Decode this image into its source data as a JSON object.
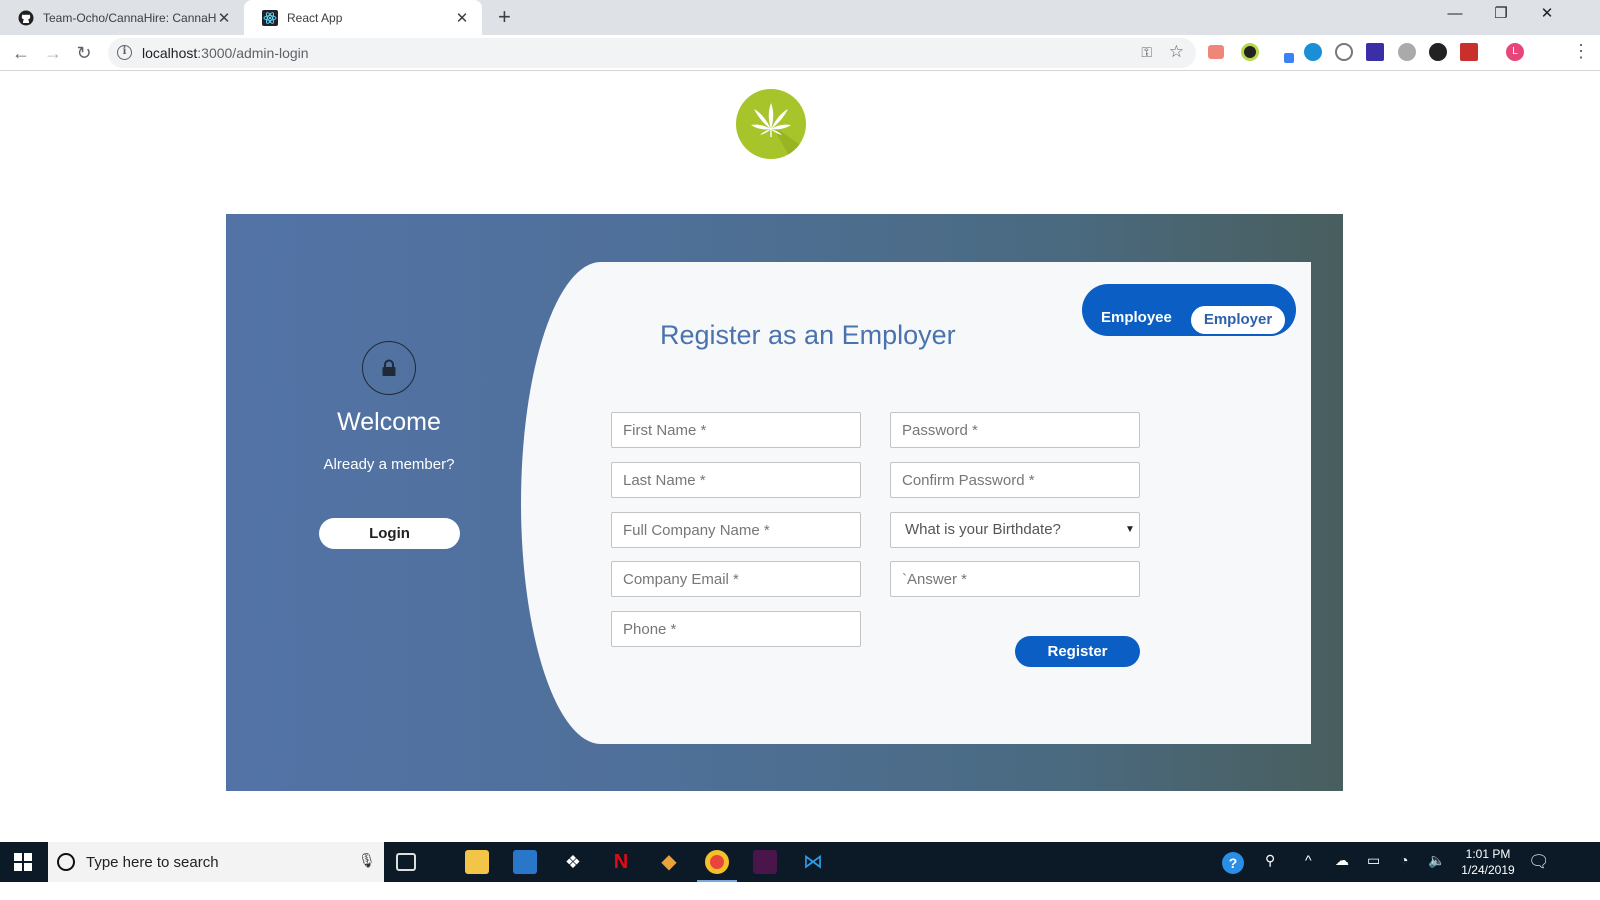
{
  "browser": {
    "tabs": [
      {
        "title": "Team-Ocho/CannaHire: CannaHi",
        "favicon": "github-icon",
        "active": false
      },
      {
        "title": "React App",
        "favicon": "react-icon",
        "active": true
      }
    ],
    "address": {
      "host": "localhost",
      "path": ":3000/admin-login"
    },
    "controls": {
      "minimize": "—",
      "restore": "❐",
      "close": "✕",
      "new_tab": "+"
    }
  },
  "page": {
    "logo": "cannabis-leaf-logo",
    "welcome": {
      "title": "Welcome",
      "subtitle": "Already a member?",
      "login_label": "Login"
    },
    "register": {
      "title": "Register as an Employer",
      "toggle": {
        "left_label": "Employee",
        "right_label": "Employer",
        "selected": "Employer"
      },
      "left_fields": [
        {
          "name": "first-name-input",
          "placeholder": "First Name *"
        },
        {
          "name": "last-name-input",
          "placeholder": "Last Name *"
        },
        {
          "name": "company-name-input",
          "placeholder": "Full Company Name *"
        },
        {
          "name": "company-email-input",
          "placeholder": "Company Email *"
        },
        {
          "name": "phone-input",
          "placeholder": "Phone *"
        }
      ],
      "right_fields": {
        "password": "Password *",
        "confirm_password": "Confirm Password *",
        "security_question": "What is your Birthdate?",
        "answer": "`Answer *"
      },
      "submit_label": "Register"
    },
    "colors": {
      "accent": "#0a5ec4",
      "panel_start": "#5373a7",
      "panel_end": "#495e5e",
      "title": "#4a73ad",
      "logo": "#a7c42a"
    }
  },
  "taskbar": {
    "search_placeholder": "Type here to search",
    "apps": [
      "file-explorer-icon",
      "store-icon",
      "dropbox-icon",
      "netflix-icon",
      "git-icon",
      "chrome-icon",
      "slack-icon",
      "vscode-icon"
    ],
    "clock": {
      "time": "1:01 PM",
      "date": "1/24/2019"
    }
  }
}
